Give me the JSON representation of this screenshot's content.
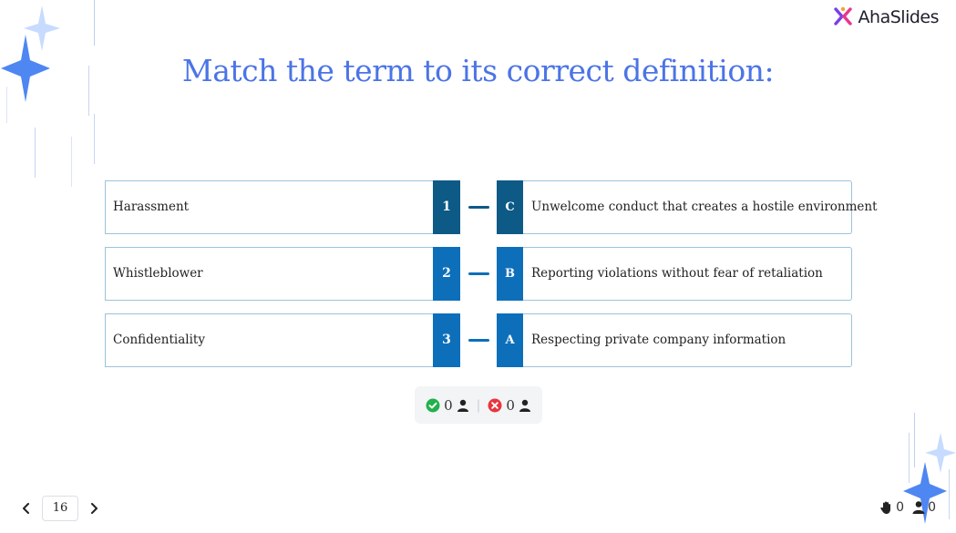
{
  "brand": {
    "name": "AhaSlides"
  },
  "slide": {
    "title": "Match the term to its correct definition:"
  },
  "pairs": [
    {
      "term": "Harassment",
      "number": "1",
      "letter": "C",
      "definition": "Unwelcome conduct that creates a hostile environment"
    },
    {
      "term": "Whistleblower",
      "number": "2",
      "letter": "B",
      "definition": "Reporting violations without fear of retaliation"
    },
    {
      "term": "Confidentiality",
      "number": "3",
      "letter": "A",
      "definition": "Respecting private company information"
    }
  ],
  "stats": {
    "correct_count": "0",
    "incorrect_count": "0"
  },
  "pager": {
    "page": "16"
  },
  "counters": {
    "hands": "0",
    "audience": "0"
  },
  "colors": {
    "accent": "#4b74e6",
    "tile_dark": "#0d5a86",
    "tile": "#0d6fba",
    "correct": "#22b14c",
    "incorrect": "#e8363f"
  },
  "icons": [
    "sparkle-icon",
    "check-circle-icon",
    "x-circle-icon",
    "user-icon",
    "chevron-left-icon",
    "chevron-right-icon",
    "raised-hand-icon",
    "audience-icon"
  ]
}
